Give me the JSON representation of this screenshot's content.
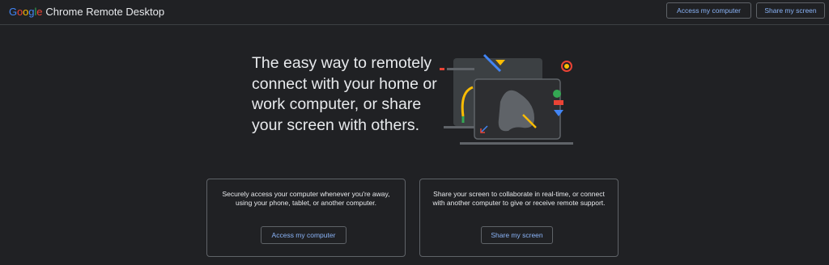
{
  "header": {
    "brand_google": "Google",
    "brand_product": "Chrome Remote Desktop",
    "access_button": "Access my computer",
    "share_button": "Share my screen"
  },
  "hero": {
    "headline": "The easy way to remotely connect with your home or work computer, or share your screen with others."
  },
  "cards": [
    {
      "description": "Securely access your computer whenever you're away, using your phone, tablet, or another computer.",
      "button": "Access my computer"
    },
    {
      "description": "Share your screen to collaborate in real-time, or connect with another computer to give or receive remote support.",
      "button": "Share my screen"
    }
  ],
  "colors": {
    "background": "#202124",
    "accent": "#8ab4f8",
    "google_blue": "#4285f4",
    "google_red": "#ea4335",
    "google_yellow": "#fbbc04",
    "google_green": "#34a853"
  }
}
